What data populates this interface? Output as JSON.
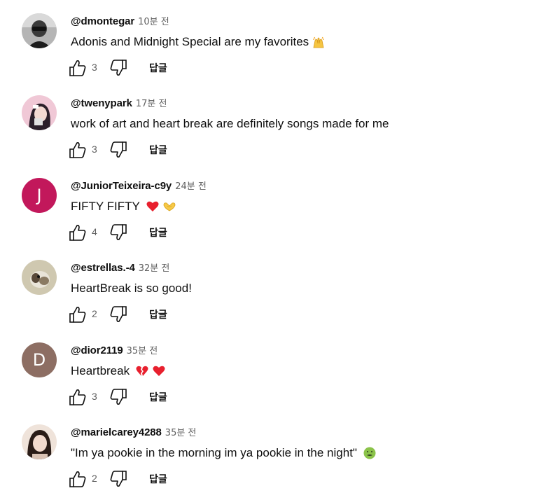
{
  "comments": [
    {
      "author": "@dmontegar",
      "time": "10분 전",
      "text": "Adonis and Midnight Special are my favorites",
      "emoji": [
        "raising-hands-emoji"
      ],
      "likes": "3",
      "reply_label": "답글",
      "avatar": {
        "type": "photo",
        "bg": "#9a9a9a"
      }
    },
    {
      "author": "@twenypark",
      "time": "17분 전",
      "text": "work of art and heart break are definitely songs made for me",
      "emoji": [],
      "likes": "3",
      "reply_label": "답글",
      "avatar": {
        "type": "photo",
        "bg": "#e9b8c8"
      }
    },
    {
      "author": "@JuniorTeixeira-c9y",
      "time": "24분 전",
      "text": "FIFTY FIFTY",
      "emoji": [
        "red-heart-emoji",
        "heart-hands-emoji"
      ],
      "likes": "4",
      "reply_label": "답글",
      "avatar": {
        "type": "letter",
        "letter": "J",
        "bg": "#c2185b"
      }
    },
    {
      "author": "@estrellas.-4",
      "time": "32분 전",
      "text": "HeartBreak is so good!",
      "emoji": [],
      "likes": "2",
      "reply_label": "답글",
      "avatar": {
        "type": "photo",
        "bg": "#c9c3ad"
      }
    },
    {
      "author": "@dior2119",
      "time": "35분 전",
      "text": "Heartbreak",
      "emoji": [
        "broken-heart-emoji",
        "red-heart-emoji"
      ],
      "likes": "3",
      "reply_label": "답글",
      "avatar": {
        "type": "letter",
        "letter": "D",
        "bg": "#8d6e63"
      }
    },
    {
      "author": "@marielcarey4288",
      "time": "35분 전",
      "text": "\"Im ya pookie in the morning im ya pookie in the night\"",
      "emoji": [
        "nauseated-face-emoji"
      ],
      "likes": "2",
      "reply_label": "답글",
      "avatar": {
        "type": "photo",
        "bg": "#e8d2c4"
      }
    }
  ],
  "colors": {
    "text_primary": "#0f0f0f",
    "text_secondary": "#606060",
    "background": "#ffffff"
  }
}
